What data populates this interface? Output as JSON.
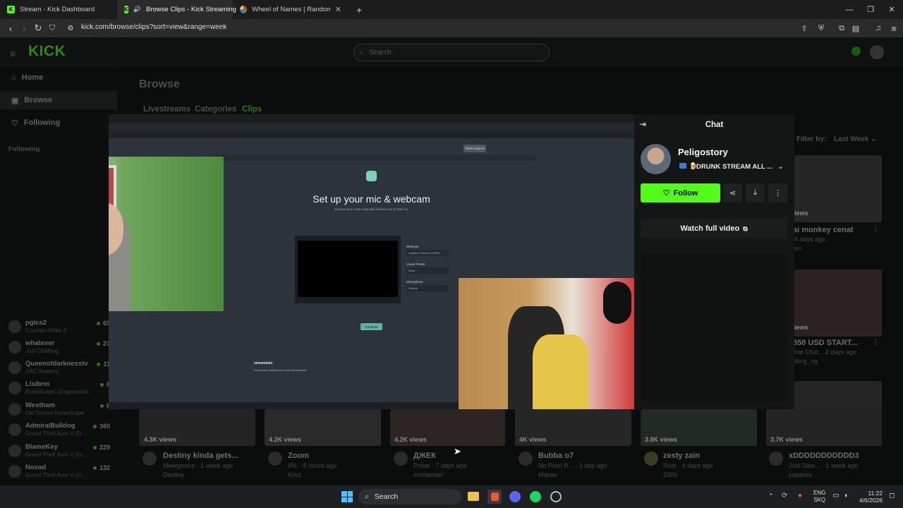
{
  "browser": {
    "tabs": [
      {
        "title": "Stream - Kick Dashboard",
        "active": false
      },
      {
        "title": "Browse Clips - Kick Streaming",
        "active": true
      },
      {
        "title": "Wheel of Names | Random name pic",
        "active": false
      }
    ],
    "url": "kick.com/browse/clips?sort=view&range=week"
  },
  "site": {
    "logo": "KICK",
    "search_placeholder": "Search",
    "nav": {
      "home": "Home",
      "browse": "Browse",
      "following": "Following"
    },
    "following_header": "Following",
    "followed": [
      {
        "name": "pglcs2",
        "game": "Counter-Strike 2",
        "count": "65"
      },
      {
        "name": "whatever",
        "game": "Just Chatting",
        "count": "27"
      },
      {
        "name": "Queenofdarknesstv",
        "game": "ARC Raiders",
        "count": "11"
      },
      {
        "name": "Llslbrm",
        "game": "RuneScape: Dragonwilds",
        "count": "8"
      },
      {
        "name": "Westham",
        "game": "Old School RuneScape",
        "count": "8"
      },
      {
        "name": "AdmiralBulldog",
        "game": "Grand Theft Auto V (G...",
        "count": "360"
      },
      {
        "name": "BlameKey",
        "game": "Grand Theft Auto V (G...",
        "count": "229"
      },
      {
        "name": "Novad",
        "game": "Grand Theft Auto V (G...",
        "count": "132"
      }
    ]
  },
  "page": {
    "title": "Browse",
    "tabs": [
      "Livestreams",
      "Categories",
      "Clips"
    ],
    "filter_label": "Filter by:",
    "filter_value": "Last Week",
    "side_clips": [
      {
        "views": "iews",
        "title": "ai monkey cenat",
        "sub": "4 days ago",
        "sub2": "on"
      },
      {
        "views": "iews",
        "title": "850 USD START...",
        "sub": "hat Chat... 2 days ago",
        "sub2": "illing_og"
      }
    ],
    "bottom_clips": [
      {
        "views": "4.3K views",
        "title": "Destiny kinda gets...",
        "cat": "Mewgenics",
        "ago": "1 week ago",
        "user": "Destiny"
      },
      {
        "views": "4.2K views",
        "title": "Zoom",
        "cat": "IRL",
        "ago": "8 hours ago",
        "user": "Knut"
      },
      {
        "views": "4.2K views",
        "title": "ДЖЕК",
        "cat": "Poker",
        "ago": "7 days ago",
        "user": "mishanner"
      },
      {
        "views": "4K views",
        "title": "Bubba o7",
        "cat": "No Pixel R...",
        "ago": "1 day ago",
        "user": "Manax"
      },
      {
        "views": "3.8K views",
        "title": "zesty zain",
        "cat": "Rust",
        "ago": "4 days ago",
        "user": "Z4IN"
      },
      {
        "views": "3.7K views",
        "title": "xDDDDDDDDDDD3",
        "cat": "Just Slee...",
        "ago": "1 week ago",
        "user": "pajalock"
      }
    ]
  },
  "modal": {
    "embedded_screen": {
      "heading": "Set up your mic & webcam",
      "subheading": "Connect your most essential devices now or later on.",
      "brand": "streamlabs",
      "brand_tagline": "Univerzální software pro živé streamování",
      "webcam_label": "Webcam",
      "webcam_value": "Logitech Webcam C930e",
      "visual_preset_label": "Visual Preset",
      "visual_preset_value": "None",
      "microphone_label": "Microphone",
      "microphone_value": "Default",
      "continue_label": "Continue",
      "panel_label": "Select panel"
    },
    "chat": {
      "header": "Chat",
      "channel": "Peligostory",
      "stream_title": "DRUNK STREAM ALL ...",
      "follow_label": "Follow",
      "watch_full_label": "Watch full video"
    }
  },
  "taskbar": {
    "search": "Search",
    "lang1": "ENG",
    "lang2": "SKQ",
    "time": "11:22",
    "date": "4/6/2026"
  },
  "colors": {
    "kick_green": "#53fc18",
    "bg": "#0b0c0c",
    "panel": "#141515"
  }
}
